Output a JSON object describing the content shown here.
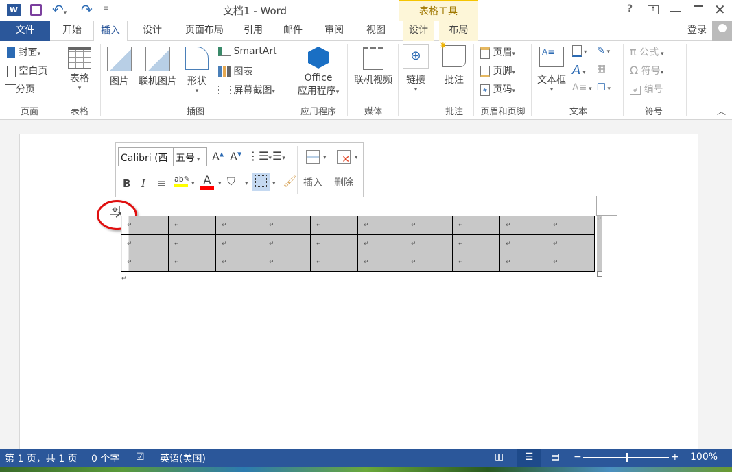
{
  "window": {
    "title": "文档1 - Word",
    "context_tab_group": "表格工具",
    "help": "?",
    "sign_in": "登录"
  },
  "tabs": [
    "文件",
    "开始",
    "插入",
    "设计",
    "页面布局",
    "引用",
    "邮件",
    "审阅",
    "视图"
  ],
  "context_tabs": [
    "设计",
    "布局"
  ],
  "ribbon": {
    "page": {
      "items": [
        "封面",
        "空白页",
        "分页"
      ],
      "label": "页面"
    },
    "table": {
      "button": "表格",
      "label": "表格"
    },
    "illustrations": {
      "picture": "图片",
      "online_picture": "联机图片",
      "shapes": "形状",
      "smartart": "SmartArt",
      "chart": "图表",
      "screenshot": "屏幕截图",
      "label": "插图"
    },
    "apps": {
      "button_line1": "Office",
      "button_line2": "应用程序",
      "label": "应用程序"
    },
    "media": {
      "button": "联机视频",
      "label": "媒体"
    },
    "links": {
      "button": "链接",
      "label": ""
    },
    "comments": {
      "button": "批注",
      "label": "批注"
    },
    "header_footer": {
      "items": [
        "页眉",
        "页脚",
        "页码"
      ],
      "label": "页眉和页脚"
    },
    "text": {
      "textbox": "文本框",
      "label": "文本"
    },
    "symbols": {
      "items": [
        "公式",
        "符号",
        "编号"
      ],
      "label": "符号"
    }
  },
  "mini_toolbar": {
    "font": "Calibri (⁠西",
    "size": "五号",
    "insert": "插入",
    "delete": "删除"
  },
  "document": {
    "rows": 3,
    "cols": 10,
    "cell_mark": "↵",
    "para_mark": "↵"
  },
  "status": {
    "page": "第 1 页，共 1 页",
    "words": "0 个字",
    "language": "英语(美国)",
    "zoom": "100%",
    "zoom_level": 100
  },
  "colors": {
    "accent": "#2b579a",
    "context": "#fdf6d8",
    "highlight": "#ffff00",
    "font_color": "#ff0000"
  }
}
